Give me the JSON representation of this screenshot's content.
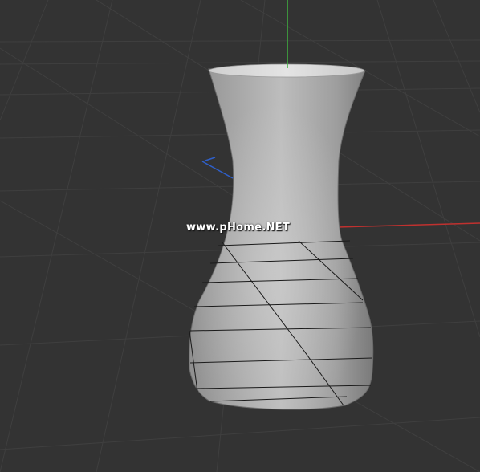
{
  "viewport": {
    "background_color": "#333333",
    "grid_color": "#3f3f3f",
    "axes": {
      "x_color": "#c0312f",
      "y_color": "#3fb33f",
      "z_color": "#2f5fc8"
    },
    "object": {
      "name": "vase",
      "shading": "gray-gradient",
      "edge_color": "#1a1a1a"
    }
  },
  "watermark": {
    "text": "www.pHome.NET"
  }
}
